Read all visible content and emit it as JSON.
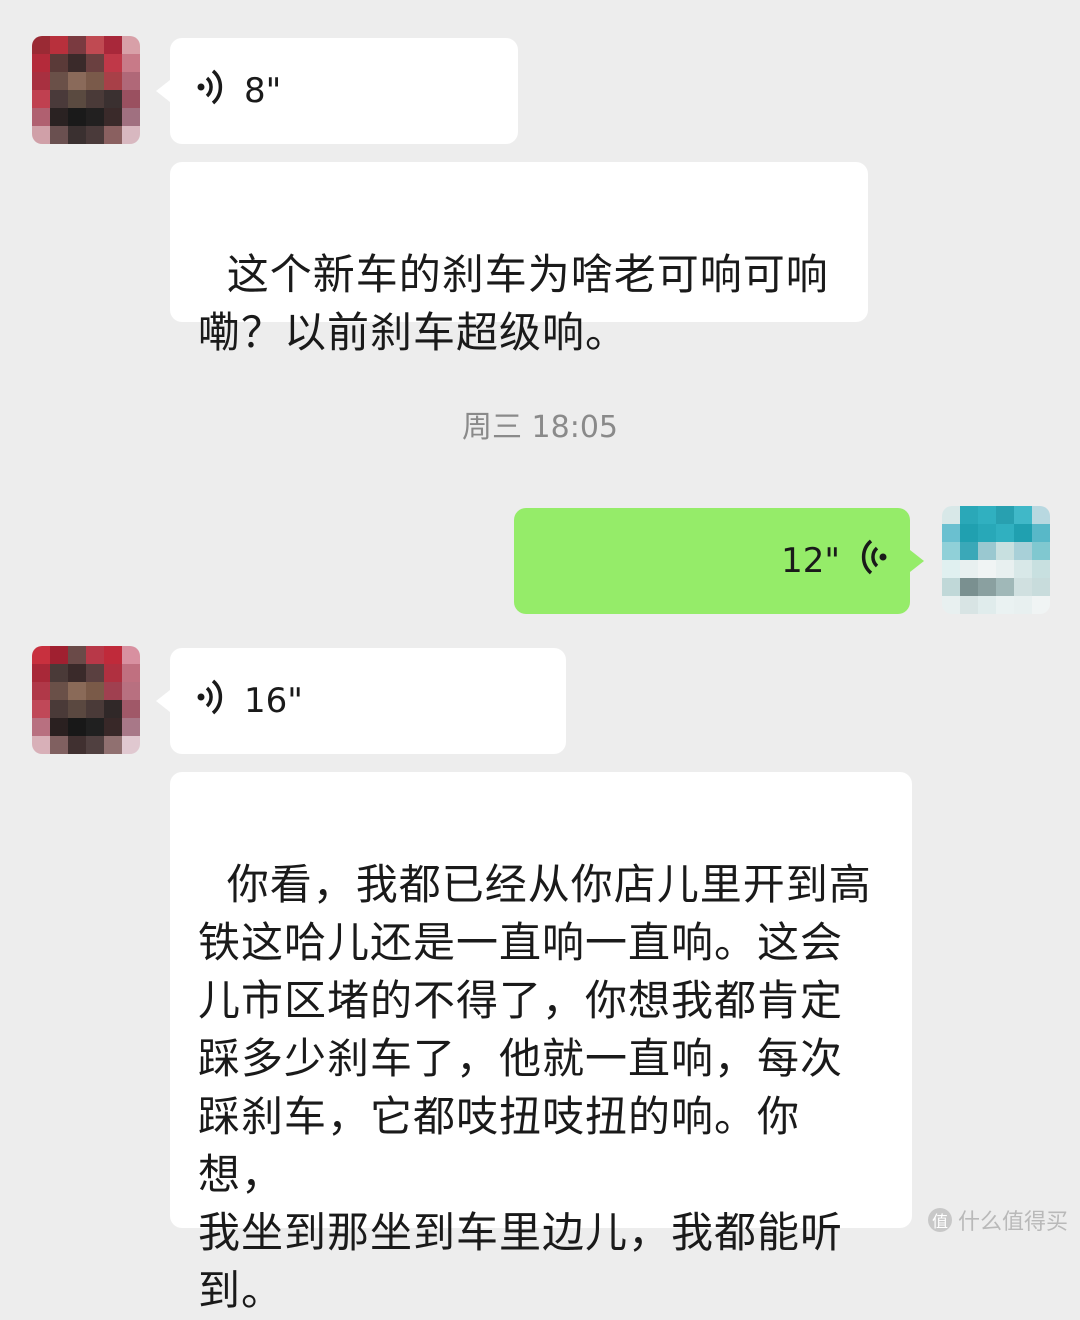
{
  "messages": [
    {
      "type": "voice",
      "side": "left",
      "duration": "8\""
    },
    {
      "type": "text",
      "side": "left",
      "text": "这个新车的刹车为啥老可响可响\n嘞？以前刹车超级响。"
    },
    {
      "type": "timestamp",
      "text": "周三 18:05"
    },
    {
      "type": "voice",
      "side": "right",
      "duration": "12\""
    },
    {
      "type": "voice",
      "side": "left",
      "duration": "16\""
    },
    {
      "type": "text",
      "side": "left",
      "text": "你看，我都已经从你店儿里开到高\n铁这哈儿还是一直响一直响。这会\n儿市区堵的不得了，你想我都肯定\n踩多少刹车了，他就一直响，每次\n踩刹车，它都吱扭吱扭的响。你想，\n我坐到那坐到车里边儿，我都能听\n到。"
    }
  ],
  "watermark": {
    "logo": "值",
    "text": "什么值得买"
  },
  "colors": {
    "background": "#ededed",
    "bubble_left": "#ffffff",
    "bubble_right": "#95ec69",
    "timestamp": "#8a8a8a"
  },
  "icons": {
    "voice_left": "voice-wave-icon",
    "voice_right": "voice-wave-icon"
  }
}
